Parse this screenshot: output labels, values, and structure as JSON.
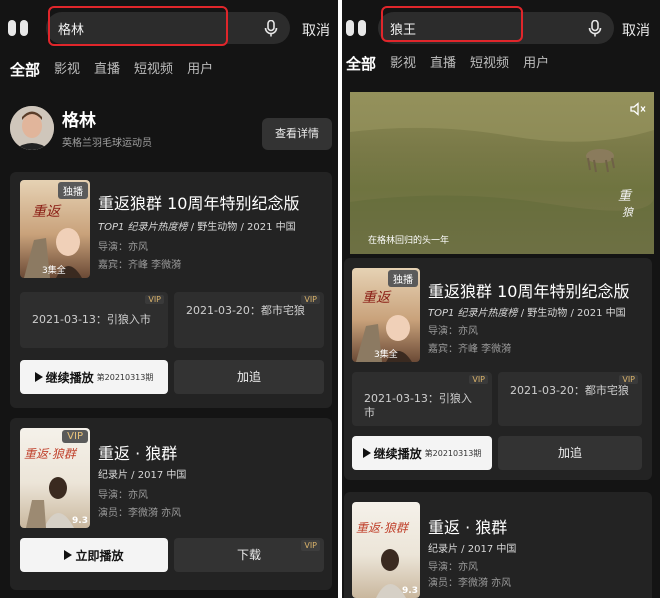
{
  "left": {
    "search": {
      "value": "格林"
    },
    "cancel_label": "取消",
    "tabs": [
      "全部",
      "影视",
      "直播",
      "短视频",
      "用户"
    ],
    "person": {
      "name": "格林",
      "desc": "英格兰羽毛球运动员",
      "detail_label": "查看详情"
    },
    "card1": {
      "badge": "独播",
      "episodes": "3集全",
      "title": "重返狼群 10周年特别纪念版",
      "meta_highlight": "TOP1 纪录片热度榜",
      "meta_rest": " / 野生动物 / 2021 中国",
      "director": "导演：亦风",
      "guests": "嘉宾：齐峰 李微漪",
      "ep1": "2021-03-13：引狼入市",
      "ep2": "2021-03-20：都市宅狼",
      "vip": "VIP",
      "play_label": "继续播放",
      "play_sub": "第20210313期",
      "add_label": "加追"
    },
    "card2": {
      "badge": "VIP",
      "rating": "9.3",
      "title": "重返 · 狼群",
      "meta": "纪录片 / 2017 中国",
      "director": "导演：亦风",
      "cast": "演员：李微漪 亦风",
      "play_label": "立即播放",
      "download_label": "下载",
      "vip": "VIP"
    }
  },
  "right": {
    "search": {
      "value": "狼王"
    },
    "cancel_label": "取消",
    "tabs": [
      "全部",
      "影视",
      "直播",
      "短视频",
      "用户"
    ],
    "video_caption": "在格林回归的头一年",
    "card1": {
      "badge": "独播",
      "episodes": "3集全",
      "title": "重返狼群 10周年特别纪念版",
      "meta_highlight": "TOP1 纪录片热度榜",
      "meta_rest": " / 野生动物 / 2021 中国",
      "director": "导演：亦风",
      "guests": "嘉宾：齐峰 李微漪",
      "ep1": "2021-03-13：引狼入市",
      "ep2": "2021-03-20：都市宅狼",
      "vip": "VIP",
      "play_label": "继续播放",
      "play_sub": "第20210313期",
      "add_label": "加追"
    },
    "card2": {
      "rating": "9.3",
      "title": "重返 · 狼群",
      "meta": "纪录片 / 2017 中国",
      "director": "导演：亦风",
      "cast": "演员：李微漪 亦风"
    }
  }
}
